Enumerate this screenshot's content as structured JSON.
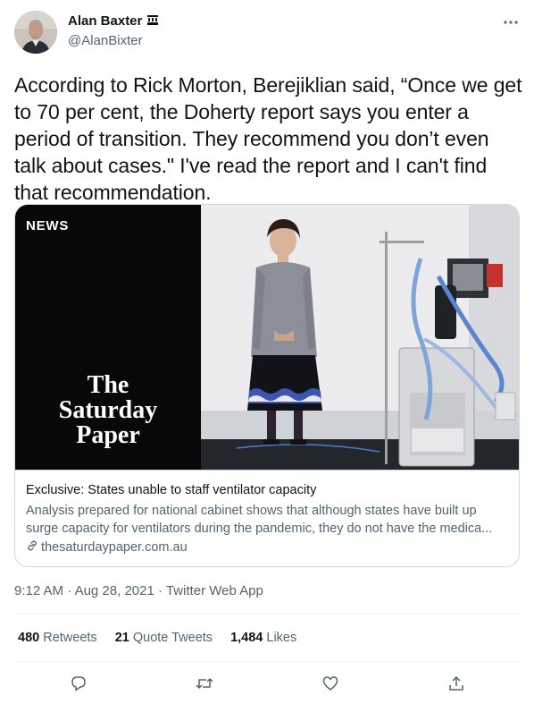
{
  "author": {
    "display_name": "Alan Baxter",
    "badge_icon": "crown-icon",
    "handle": "@AlanBixter"
  },
  "tweet": {
    "text": "According to Rick Morton, Berejiklian said, “Once we get to 70 per cent, the Doherty report says you enter a period of transition. They recommend you don’t even talk about cases.\" I've read the report and I can't find that recommendation."
  },
  "card": {
    "media_label": "NEWS",
    "masthead": [
      "The",
      "Saturday",
      "Paper"
    ],
    "title": "Exclusive: States unable to staff ventilator capacity",
    "description_line1": "Analysis prepared for national cabinet shows that although states have built up",
    "description_line2": "surge capacity for ventilators during the pandemic, they do not have the medica...",
    "domain": "thesaturdaypaper.com.au",
    "domain_icon": "link-icon"
  },
  "meta": {
    "time": "9:12 AM",
    "separator": "·",
    "date": "Aug 28, 2021",
    "source": "Twitter Web App"
  },
  "stats": {
    "retweets": {
      "count": "480",
      "label": "Retweets"
    },
    "quotes": {
      "count": "21",
      "label": "Quote Tweets"
    },
    "likes": {
      "count": "1,484",
      "label": "Likes"
    }
  },
  "actions": [
    "reply-icon",
    "retweet-icon",
    "like-icon",
    "share-icon"
  ],
  "colors": {
    "text": "#0f1419",
    "secondary": "#536471",
    "border": "#cfd9de",
    "divider": "#eff3f4"
  }
}
